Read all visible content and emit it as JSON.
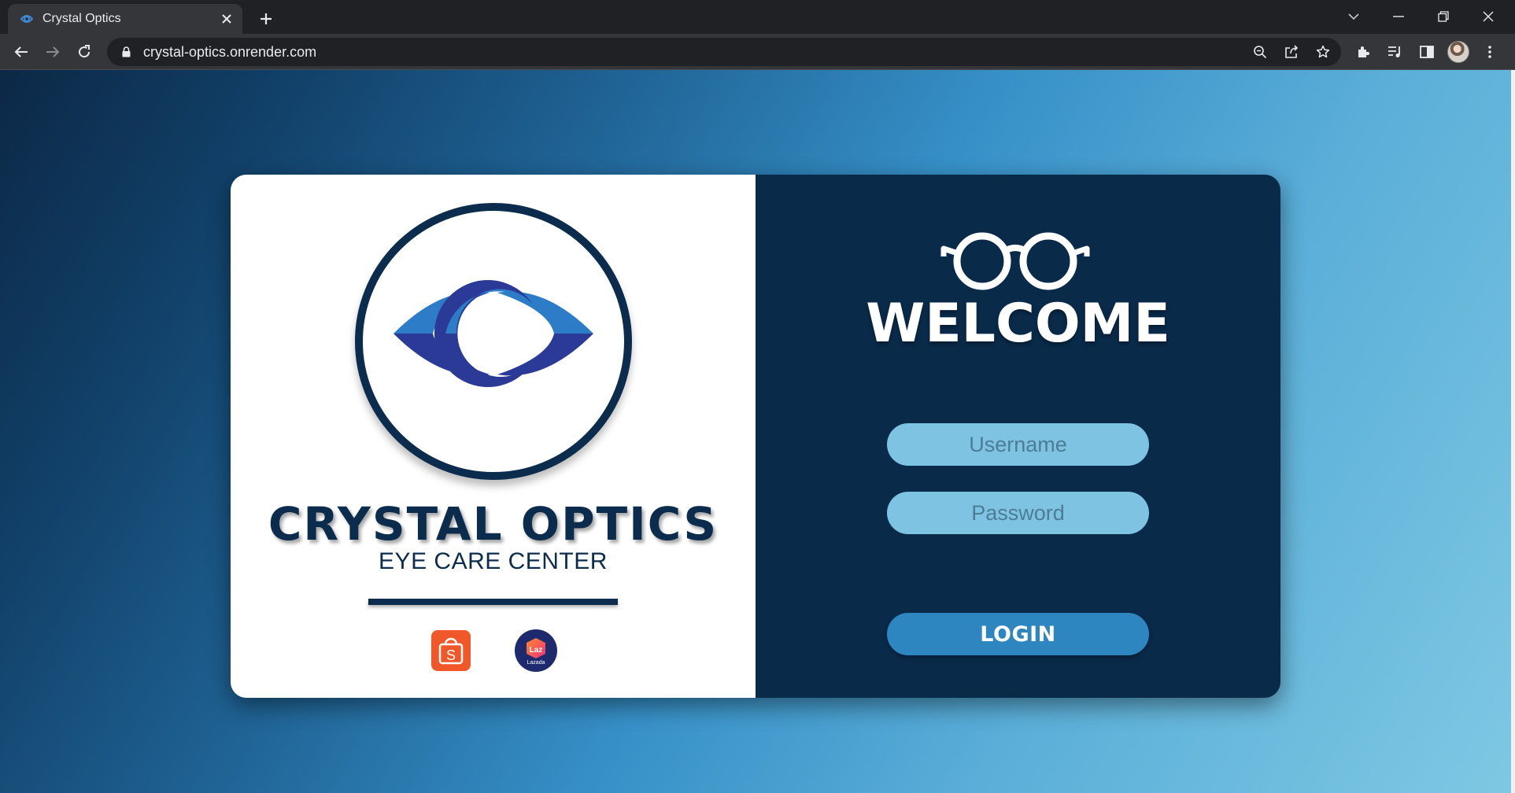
{
  "browser": {
    "tab": {
      "title": "Crystal Optics",
      "favicon": "crystal-optics-logo-icon"
    },
    "new_tab_icon": "plus-icon",
    "window_controls": [
      "tab-search-icon",
      "minimize-icon",
      "restore-icon",
      "close-icon"
    ],
    "address_bar": {
      "url": "crystal-optics.onrender.com",
      "security_icon": "lock-icon"
    },
    "omnibox_icons": [
      "zoom-icon",
      "share-icon",
      "bookmark-star-icon"
    ],
    "toolbar_icons": [
      "extensions-icon",
      "media-icon",
      "side-panel-icon",
      "profile-avatar",
      "menu-icon"
    ]
  },
  "page": {
    "brand": {
      "title": "CRYSTAL OPTICS",
      "subtitle": "EYE CARE CENTER",
      "logo_icon": "eye-logo-icon",
      "stores": [
        {
          "name": "Shopee",
          "icon": "shopee-icon",
          "glyph": "S",
          "color": "#f0582a"
        },
        {
          "name": "Lazada",
          "icon": "lazada-icon",
          "glyph": "Laz",
          "caption": "Lazada",
          "color": "#1d2a6d"
        }
      ]
    },
    "login": {
      "icon": "glasses-icon",
      "heading": "WELCOME",
      "username_placeholder": "Username",
      "password_placeholder": "Password",
      "button_label": "LOGIN"
    },
    "colors": {
      "navy": "#0b2c4c",
      "panel": "#0a2a4a",
      "field": "#7ec3e2",
      "button": "#2e86c1",
      "eye_light": "#2c7cc8",
      "eye_dark": "#2a3a96"
    }
  }
}
